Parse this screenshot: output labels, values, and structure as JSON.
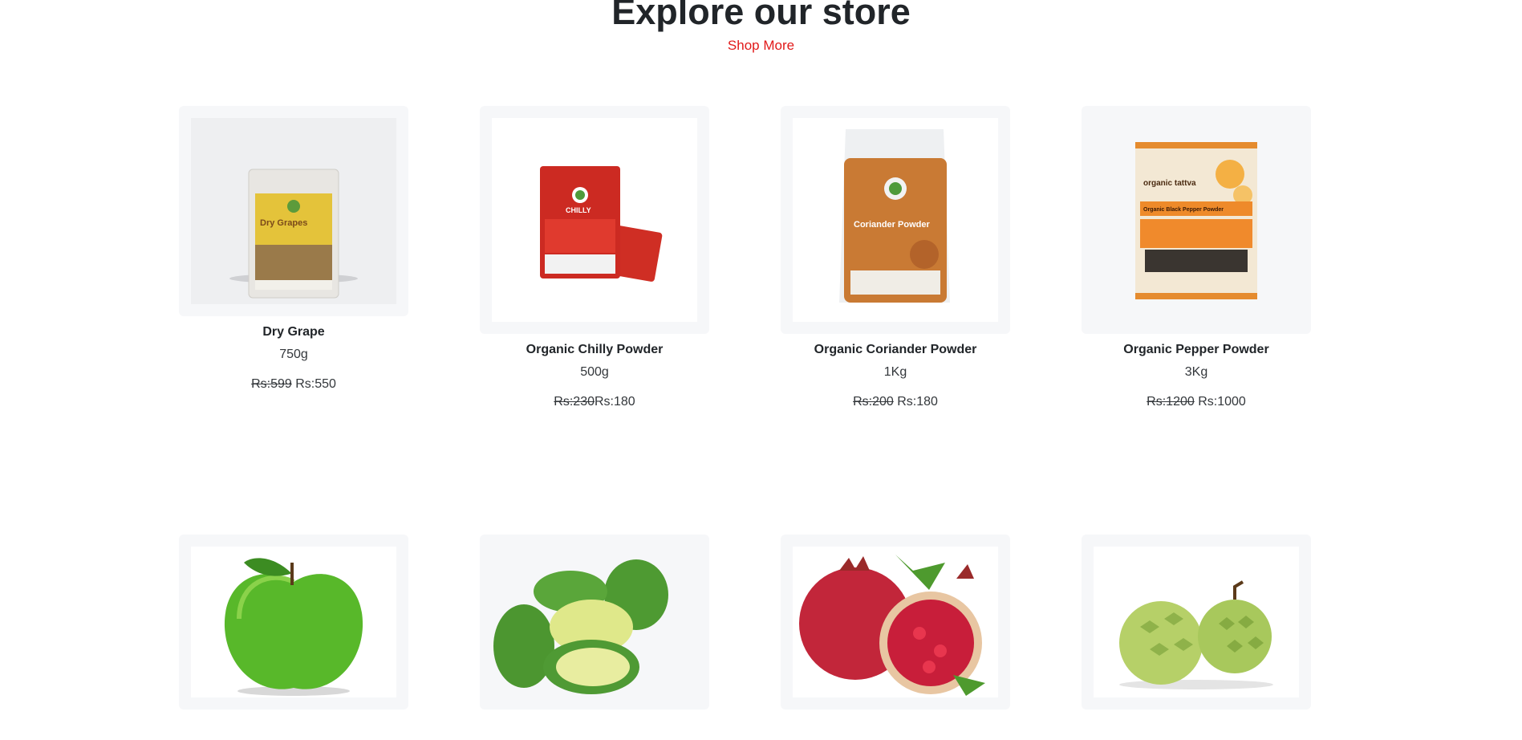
{
  "section": {
    "title": "Explore our store",
    "link": "Shop More"
  },
  "products": [
    {
      "name": "Dry Grape",
      "weight": "750g",
      "old_price": "Rs:599",
      "price": "Rs:550"
    },
    {
      "name": "Organic Chilly Powder",
      "weight": "500g",
      "old_price": "Rs:230",
      "price": "Rs:180"
    },
    {
      "name": "Organic Coriander Powder",
      "weight": "1Kg",
      "old_price": "Rs:200",
      "price": "Rs:180"
    },
    {
      "name": "Organic Pepper Powder",
      "weight": "3Kg",
      "old_price": "Rs:1200",
      "price": "Rs:1000"
    }
  ],
  "fruit_products": [
    {
      "image": "green-apple"
    },
    {
      "image": "green-mango"
    },
    {
      "image": "pomegranate"
    },
    {
      "image": "custard-apple"
    }
  ],
  "packaging": {
    "grape_label": "Dry Grapes",
    "chilly_label": "CHILLY",
    "coriander_label": "Coriander Powder",
    "pepper_brand": "organic tattva",
    "pepper_label": "Organic Black Pepper Powder"
  },
  "colors": {
    "accent": "#e11a1a",
    "card_bg": "#f6f7f9"
  }
}
